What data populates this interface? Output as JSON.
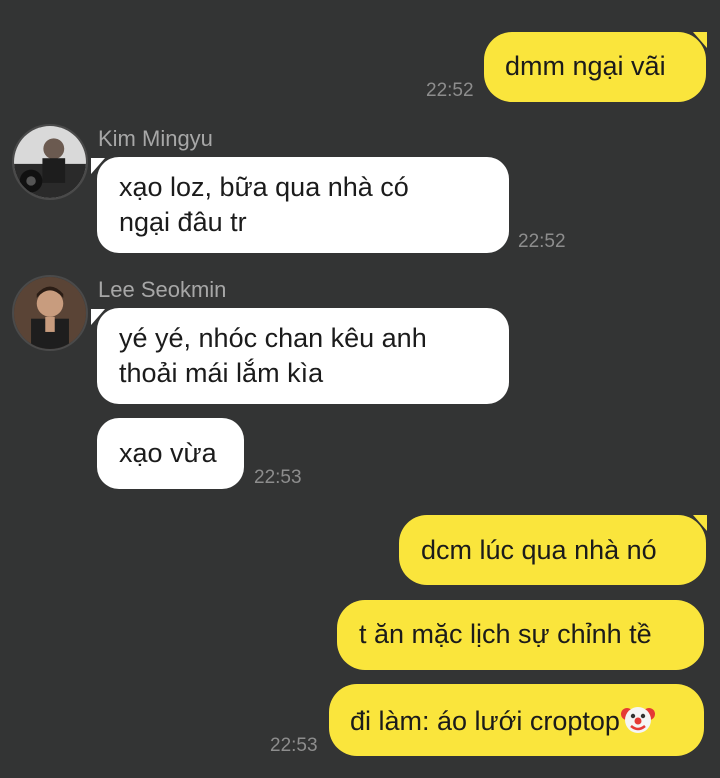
{
  "messages": {
    "m1": {
      "text": "dmm ngại vãi",
      "time": "22:52"
    },
    "m2": {
      "sender": "Kim Mingyu",
      "line1": "xạo loz, bữa qua nhà có",
      "line2": "ngại đâu tr",
      "time": "22:52"
    },
    "m3": {
      "sender": "Lee Seokmin",
      "line1": "yé yé, nhóc chan kêu anh",
      "line2": "thoải mái lắm kìa"
    },
    "m4": {
      "text": "xạo vừa",
      "time": "22:53"
    },
    "m5": {
      "text": "dcm lúc qua nhà nó"
    },
    "m6": {
      "text": "t ăn mặc lịch sự chỉnh tề"
    },
    "m7": {
      "text": "đi làm: áo lưới croptop",
      "emoji": "clown-face-icon",
      "time": "22:53"
    }
  },
  "colors": {
    "background": "#333434",
    "my_bubble": "#fae53c",
    "their_bubble": "#ffffff",
    "timestamp": "#8d8d8d",
    "sender_name": "#a7a7a7"
  }
}
